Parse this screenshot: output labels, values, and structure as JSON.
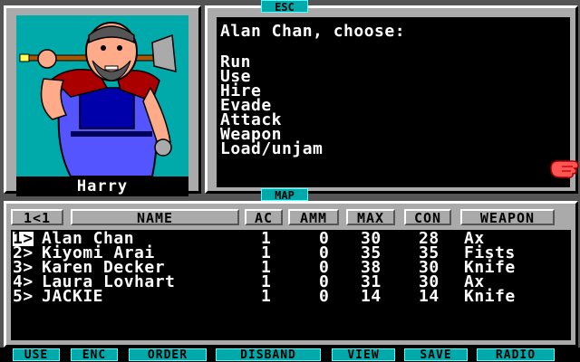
{
  "portrait": {
    "name": "Harry"
  },
  "window_tags": {
    "esc": "ESC",
    "map": "MAP"
  },
  "message": {
    "prompt": "Alan Chan, choose:",
    "options": [
      "Run",
      "Use",
      "Hire",
      "Evade",
      "Attack",
      "Weapon",
      "Load/unjam"
    ]
  },
  "party": {
    "columns": {
      "page": "1<1",
      "name": "NAME",
      "ac": "AC",
      "amm": "AMM",
      "max": "MAX",
      "con": "CON",
      "weapon": "WEAPON"
    },
    "members": [
      {
        "slot": "1>",
        "name": "Alan Chan",
        "ac": "1",
        "amm": "0",
        "max": "30",
        "con": "28",
        "weapon": "Ax",
        "selected": true
      },
      {
        "slot": "2>",
        "name": "Kiyomi Arai",
        "ac": "1",
        "amm": "0",
        "max": "35",
        "con": "35",
        "weapon": "Fists",
        "selected": false
      },
      {
        "slot": "3>",
        "name": "Karen Decker",
        "ac": "1",
        "amm": "0",
        "max": "38",
        "con": "30",
        "weapon": "Knife",
        "selected": false
      },
      {
        "slot": "4>",
        "name": "Laura Lovhart",
        "ac": "1",
        "amm": "0",
        "max": "31",
        "con": "30",
        "weapon": "Ax",
        "selected": false
      },
      {
        "slot": "5>",
        "name": "JACKIE",
        "ac": "1",
        "amm": "0",
        "max": "14",
        "con": "14",
        "weapon": "Knife",
        "selected": false
      }
    ]
  },
  "commands": [
    "USE",
    "ENC",
    "ORDER",
    "DISBAND",
    "VIEW",
    "SAVE",
    "RADIO"
  ],
  "icons": {
    "pointer": "pointing-hand-icon"
  },
  "colors": {
    "cyan": "#00aaaa",
    "gray": "#aaaaaa",
    "dark_gray": "#555555",
    "hand": "#ff5555"
  }
}
